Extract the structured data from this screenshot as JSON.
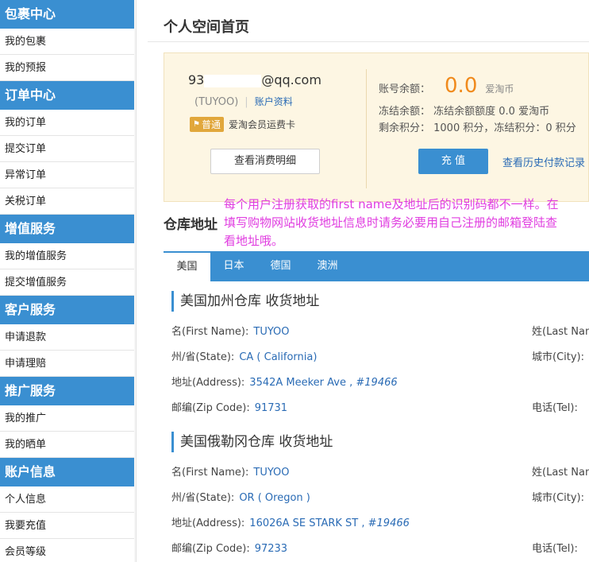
{
  "sidebar": {
    "sections": [
      {
        "title": "包裹中心",
        "items": [
          "我的包裹",
          "我的预报"
        ]
      },
      {
        "title": "订单中心",
        "items": [
          "我的订单",
          "提交订单",
          "异常订单",
          "关税订单"
        ]
      },
      {
        "title": "增值服务",
        "items": [
          "我的增值服务",
          "提交增值服务"
        ]
      },
      {
        "title": "客户服务",
        "items": [
          "申请退款",
          "申请理赔"
        ]
      },
      {
        "title": "推广服务",
        "items": [
          "我的推广",
          "我的晒单"
        ]
      },
      {
        "title": "账户信息",
        "items": [
          "个人信息",
          "我要充值",
          "会员等级"
        ]
      }
    ]
  },
  "page": {
    "title": "个人空间首页"
  },
  "account": {
    "email_prefix": "93",
    "email_suffix": "@qq.com",
    "username": "(TUYOO)",
    "profile_link": "账户资料",
    "badge": "普通",
    "member_card": "爱淘会员运费卡",
    "detail_button": "查看消费明细",
    "balance_label": "账号余额：",
    "balance_value": "0.0",
    "coin_unit": "爱淘币",
    "frozen_text": "冻结余额： 冻结余额额度 0.0 爱淘币",
    "points_text": "剩余积分： 1000 积分，冻结积分：0 积分",
    "charge_button": "充 值",
    "history_link": "查看历史付款记录"
  },
  "warehouse": {
    "title": "仓库地址",
    "annotation": "每个用户注册获取的first name及地址后的识别码都不一样。在填写购物网站收货地址信息时请务必要用自己注册的邮箱登陆查看地址哦。",
    "tabs": [
      "美国",
      "日本",
      "德国",
      "澳洲"
    ],
    "addresses": [
      {
        "title": "美国加州仓库 收货地址",
        "first_name_label": "名(First Name):",
        "first_name": "TUYOO",
        "last_name_label": "姓(Last Name",
        "state_label": "州/省(State):",
        "state": "CA ( California)",
        "city_label": "城市(City):",
        "address_label": "地址(Address):",
        "address": "3542A Meeker Ave ,",
        "address_code": "#19466",
        "zip_label": "邮编(Zip Code):",
        "zip": "91731",
        "tel_label": "电话(Tel):"
      },
      {
        "title": "美国俄勒冈仓库 收货地址",
        "first_name_label": "名(First Name):",
        "first_name": "TUYOO",
        "last_name_label": "姓(Last Name",
        "state_label": "州/省(State):",
        "state": "OR ( Oregon )",
        "city_label": "城市(City):",
        "address_label": "地址(Address):",
        "address": "16026A SE STARK ST ,",
        "address_code": "#19466",
        "zip_label": "邮编(Zip Code):",
        "zip": "97233",
        "tel_label": "电话(Tel):"
      }
    ]
  },
  "colors": {
    "accent": "#3a8fd1",
    "balance": "#f08a1c",
    "annotation": "#e03de0",
    "card_bg": "#fdf6e3"
  }
}
